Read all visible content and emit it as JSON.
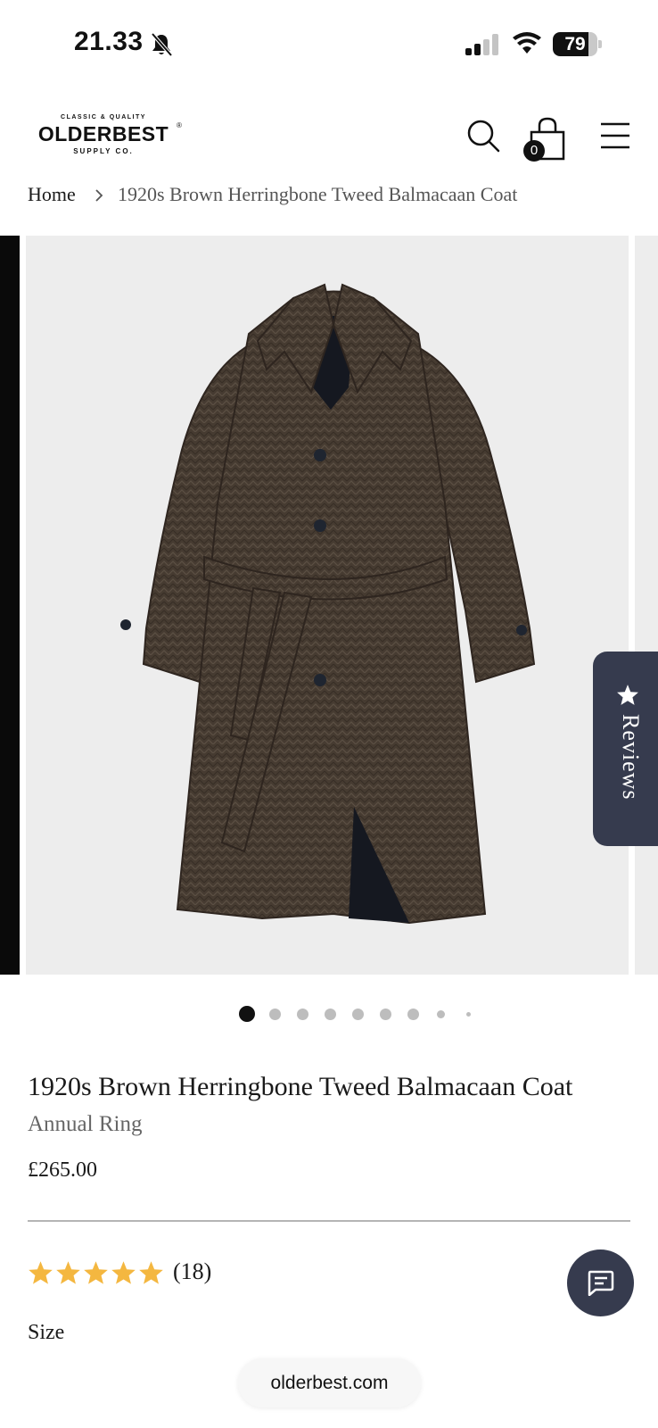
{
  "status_bar": {
    "time": "21.33",
    "battery_level": "79",
    "battery_fraction": 0.79,
    "icons": [
      "bell-slash-icon",
      "signal-icon",
      "wifi-icon",
      "battery-icon"
    ]
  },
  "header": {
    "logo": {
      "top": "CLASSIC & QUALITY",
      "main": "OLDERBEST",
      "registered": "®",
      "sub": "SUPPLY CO."
    },
    "cart_count": "0",
    "icons": [
      "search-icon",
      "shopping-bag-icon",
      "menu-icon"
    ]
  },
  "breadcrumb": {
    "home": "Home",
    "current": "1920s Brown Herringbone Tweed Balmacaan Coat"
  },
  "gallery": {
    "slide_count": 9,
    "active_index": 0,
    "reviews_tab": "Reviews"
  },
  "product": {
    "title": "1920s Brown Herringbone Tweed Balmacaan Coat",
    "vendor": "Annual Ring",
    "price": "£265.00",
    "rating": 5,
    "rating_count": "(18)",
    "size_label": "Size"
  },
  "browser": {
    "url": "olderbest.com"
  },
  "colors": {
    "accent_dark": "#363b4e",
    "star": "#f4b740",
    "coat_brown": "#4a3e33"
  }
}
